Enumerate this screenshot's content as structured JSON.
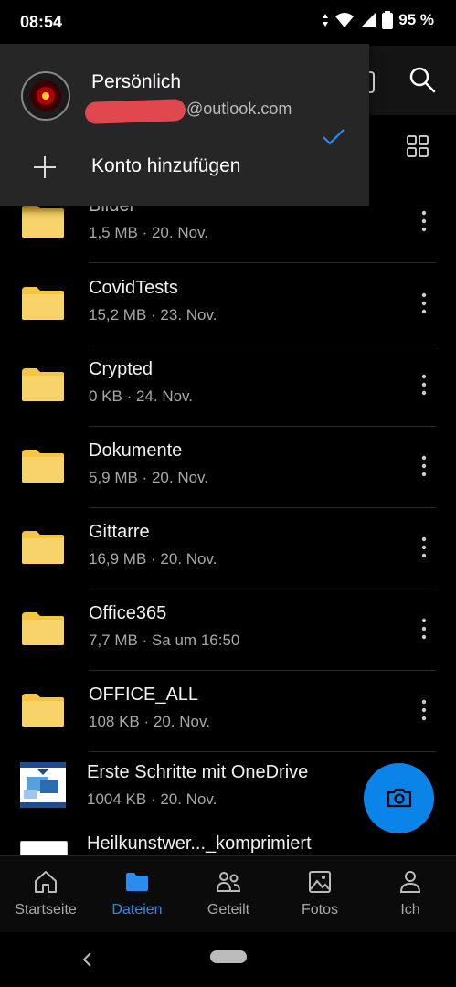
{
  "status": {
    "time": "08:54",
    "battery": "95 %"
  },
  "dropdown": {
    "account_name": "Persönlich",
    "account_email": "@outlook.com",
    "add_account_label": "Konto hinzufügen"
  },
  "files": [
    {
      "name": "Bilder",
      "meta": "1,5 MB · 20. Nov.",
      "type": "folder"
    },
    {
      "name": "CovidTests",
      "meta": "15,2 MB · 23. Nov.",
      "type": "folder"
    },
    {
      "name": "Crypted",
      "meta": "0 KB · 24. Nov.",
      "type": "folder"
    },
    {
      "name": "Dokumente",
      "meta": "5,9 MB · 20. Nov.",
      "type": "folder"
    },
    {
      "name": "Gittarre",
      "meta": "16,9 MB · 20. Nov.",
      "type": "folder"
    },
    {
      "name": "Office365",
      "meta": "7,7 MB · Sa um 16:50",
      "type": "folder"
    },
    {
      "name": "OFFICE_ALL",
      "meta": "108 KB · 20. Nov.",
      "type": "folder"
    },
    {
      "name": "Erste Schritte mit OneDrive",
      "meta": "1004 KB · 20. Nov.",
      "type": "document"
    },
    {
      "name": "Heilkunstwer..._komprimiert",
      "meta": "",
      "type": "document"
    }
  ],
  "bottom_nav": [
    {
      "label": "Startseite",
      "icon": "home-icon",
      "active": false
    },
    {
      "label": "Dateien",
      "icon": "folder-icon",
      "active": true
    },
    {
      "label": "Geteilt",
      "icon": "people-icon",
      "active": false
    },
    {
      "label": "Fotos",
      "icon": "image-icon",
      "active": false
    },
    {
      "label": "Ich",
      "icon": "person-icon",
      "active": false
    }
  ],
  "colors": {
    "accent": "#0a84e8",
    "folder": "#f6c542",
    "background": "#000000"
  }
}
